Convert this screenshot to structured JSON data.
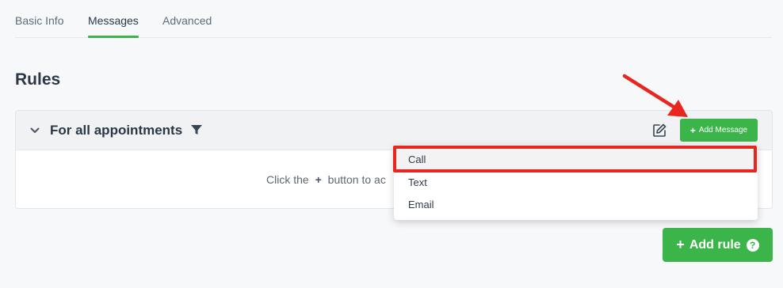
{
  "tabs": [
    {
      "label": "Basic Info",
      "active": false
    },
    {
      "label": "Messages",
      "active": true
    },
    {
      "label": "Advanced",
      "active": false
    }
  ],
  "section_title": "Rules",
  "rule": {
    "title": "For all appointments",
    "add_message_label": "Add Message",
    "empty_hint_before": "Click the",
    "empty_hint_after": "button to ac"
  },
  "dropdown": {
    "items": [
      "Call",
      "Text",
      "Email"
    ],
    "highlighted": "Call"
  },
  "add_rule_label": "Add rule",
  "colors": {
    "accent": "#3bb54a",
    "annotation": "#e8251f",
    "heading": "#2b3745"
  },
  "icons": [
    "chevron-down-icon",
    "filter-icon",
    "edit-icon",
    "plus-icon",
    "help-icon"
  ]
}
